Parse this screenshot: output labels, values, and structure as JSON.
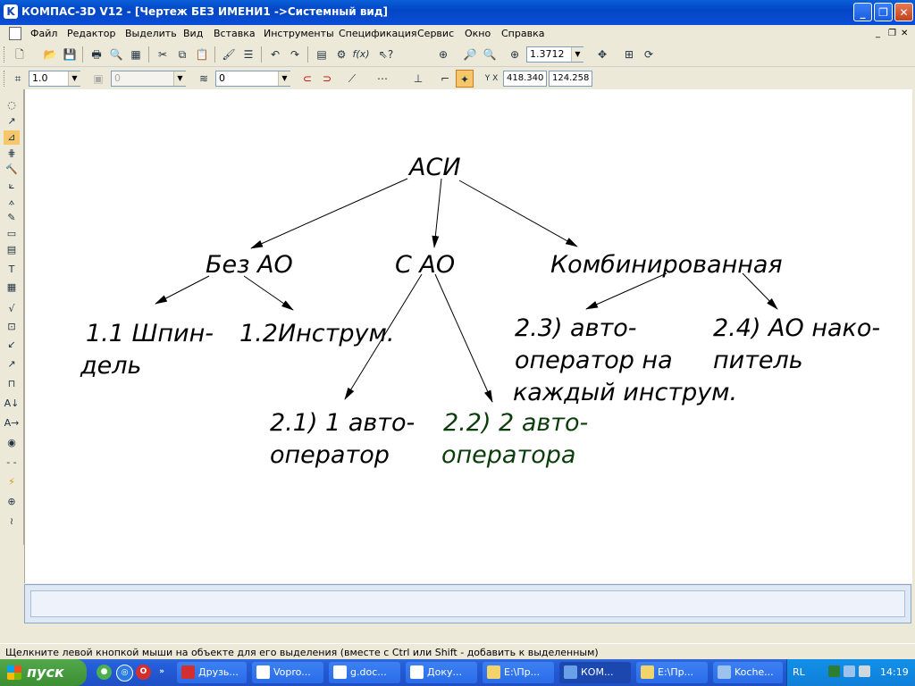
{
  "window": {
    "title": "КОМПАС-3D V12 - [Чертеж БЕЗ ИМЕНИ1 ->Системный вид]",
    "app_icon_letter": "K"
  },
  "menu": {
    "items": [
      "Файл",
      "Редактор",
      "Выделить",
      "Вид",
      "Вставка",
      "Инструменты",
      "Спецификация",
      "Сервис",
      "Окно",
      "Справка"
    ]
  },
  "toolbar": {
    "zoom_value": "1.3712",
    "fx_label": "f(x)"
  },
  "properties_bar": {
    "scale_value": "1.0",
    "layer_disabled_value": "0",
    "layer_value": "0",
    "x_coord": "418.340",
    "y_coord": "124.258"
  },
  "drawing": {
    "root": "АСИ",
    "left_node": "Без АО",
    "middle_node": "С АО",
    "right_node": "Комбинированная",
    "left_children": [
      [
        "1.1 Шпин-",
        "дель"
      ],
      [
        "1.2Инструм."
      ]
    ],
    "middle_children": [
      [
        "2.1) 1 авто-",
        "оператор"
      ],
      [
        "2.2) 2 авто-",
        "оператора"
      ]
    ],
    "right_children": [
      [
        "2.3) авто-",
        "оператор на",
        "каждый инструм."
      ],
      [
        "2.4) АО нако-",
        "питель"
      ]
    ]
  },
  "status": {
    "hint": "Щелкните левой кнопкой мыши на объекте для его выделения (вместе с Ctrl или Shift - добавить к выделенным)"
  },
  "taskbar": {
    "start_label": "пуск",
    "tasks": [
      "Друзь...",
      "Vopro...",
      "g.doc...",
      "Доку...",
      "E:\\Пр...",
      "КОМ...",
      "E:\\Пр...",
      "Koche..."
    ],
    "language": "RL",
    "time": "14:19"
  }
}
